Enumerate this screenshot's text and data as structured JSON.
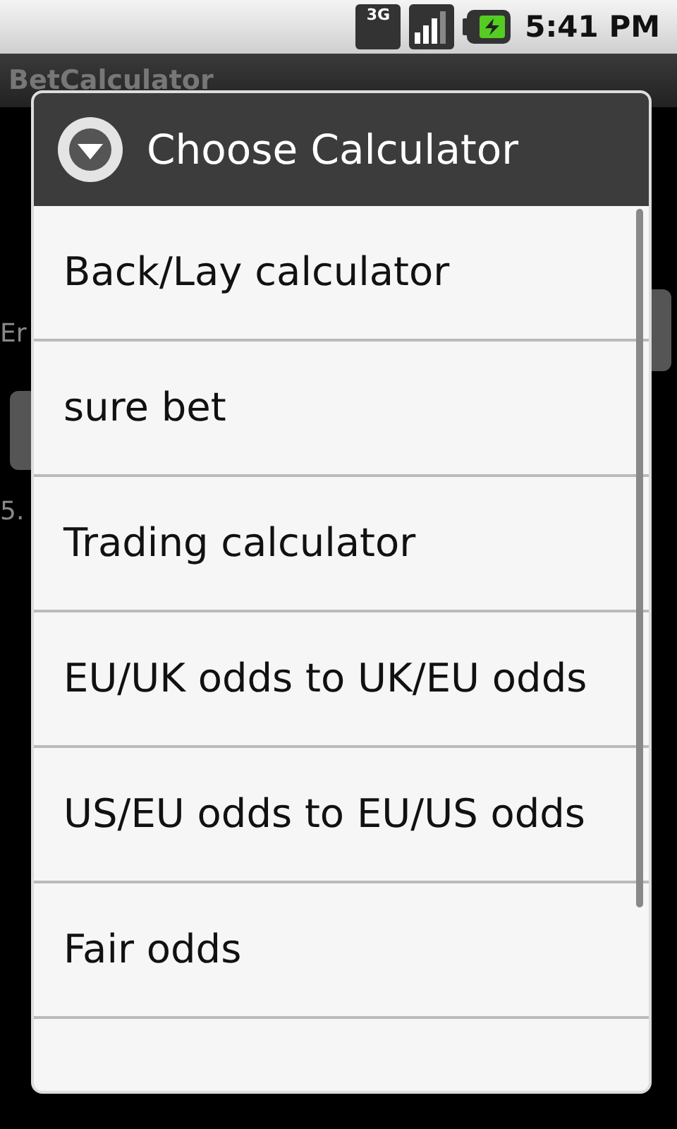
{
  "status_bar": {
    "network": "3G",
    "time": "5:41 PM"
  },
  "app": {
    "title": "BetCalculator",
    "background_texts": [
      "Er",
      "5."
    ]
  },
  "dialog": {
    "title": "Choose Calculator",
    "items": [
      {
        "label": "Back/Lay calculator"
      },
      {
        "label": "sure bet"
      },
      {
        "label": "Trading calculator"
      },
      {
        "label": "EU/UK odds to UK/EU odds"
      },
      {
        "label": "US/EU odds to EU/US odds"
      },
      {
        "label": "Fair odds"
      }
    ]
  }
}
